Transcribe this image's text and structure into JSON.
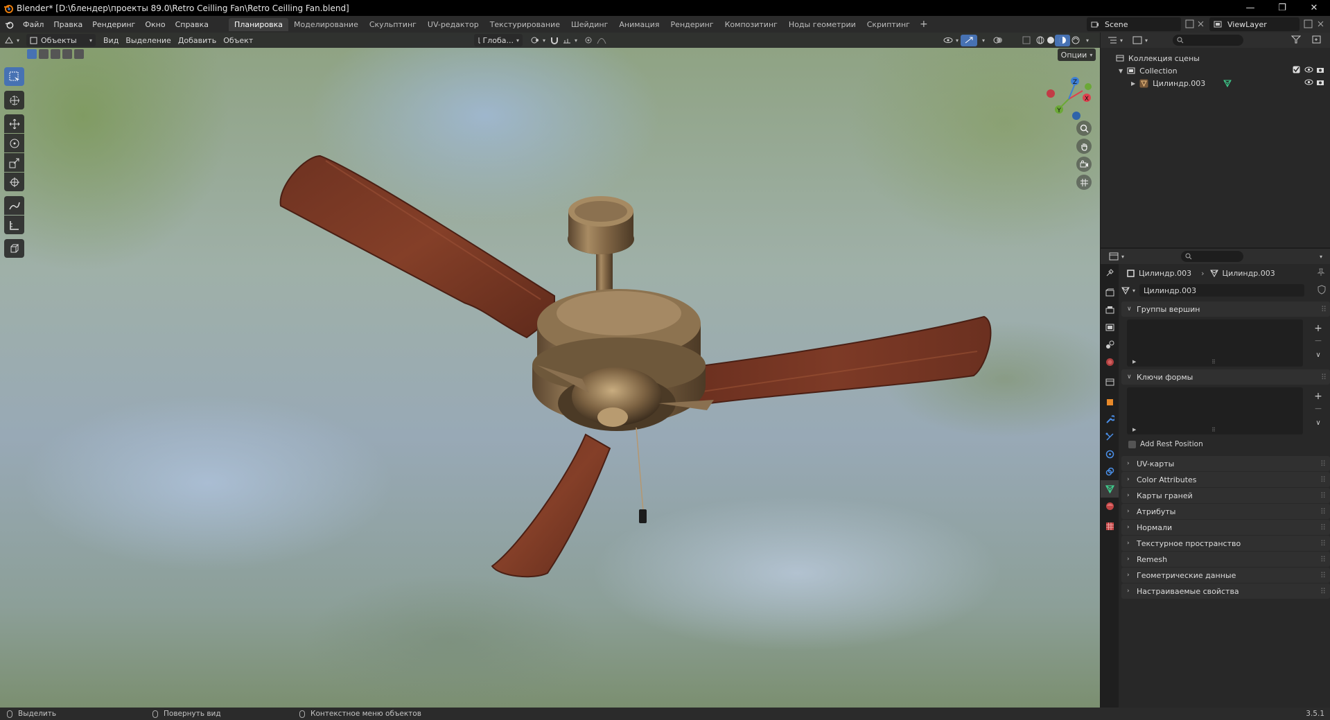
{
  "window": {
    "title": "Blender* [D:\\блендер\\проекты 89.0\\Retro Ceilling Fan\\Retro Ceilling Fan.blend]",
    "minimize": "—",
    "maximize": "❐",
    "close": "✕"
  },
  "menus": [
    "Файл",
    "Правка",
    "Рендеринг",
    "Окно",
    "Справка"
  ],
  "workspaces": [
    {
      "label": "Планировка",
      "active": true
    },
    {
      "label": "Моделирование"
    },
    {
      "label": "Скульптинг"
    },
    {
      "label": "UV-редактор"
    },
    {
      "label": "Текстурирование"
    },
    {
      "label": "Шейдинг"
    },
    {
      "label": "Анимация"
    },
    {
      "label": "Рендеринг"
    },
    {
      "label": "Композитинг"
    },
    {
      "label": "Ноды геометрии"
    },
    {
      "label": "Скриптинг"
    }
  ],
  "add_workspace": "+",
  "scene": {
    "label": "Scene"
  },
  "view_layer": {
    "label": "ViewLayer"
  },
  "viewport": {
    "mode": "Объекты",
    "menus": [
      "Вид",
      "Выделение",
      "Добавить",
      "Объект"
    ],
    "transform_orientation": "Глоба...",
    "options": "Опции",
    "gizmo_axes": {
      "x": "X",
      "y": "Y",
      "z": "Z"
    }
  },
  "outliner": {
    "root": "Коллекция сцены",
    "collection": "Collection",
    "object": "Цилиндр.003"
  },
  "properties": {
    "breadcrumb_object": "Цилиндр.003",
    "breadcrumb_data": "Цилиндр.003",
    "mesh_name": "Цилиндр.003",
    "panels": {
      "vertex_groups": "Группы вершин",
      "shape_keys": "Ключи формы",
      "add_rest_position": "Add Rest Position"
    },
    "collapsed_panels": [
      "UV-карты",
      "Color Attributes",
      "Карты граней",
      "Атрибуты",
      "Нормали",
      "Текстурное пространство",
      "Remesh",
      "Геометрические данные",
      "Настраиваемые свойства"
    ]
  },
  "statusbar": {
    "select": "Выделить",
    "rotate_view": "Повернуть вид",
    "context_menu": "Контекстное меню объектов",
    "version": "3.5.1"
  },
  "colors": {
    "accent": "#4772b3",
    "x_axis": "#e0404e",
    "y_axis": "#6ba837",
    "z_axis": "#3d7fd6",
    "wood": "#7a3a22",
    "brass": "#8a6e48"
  }
}
